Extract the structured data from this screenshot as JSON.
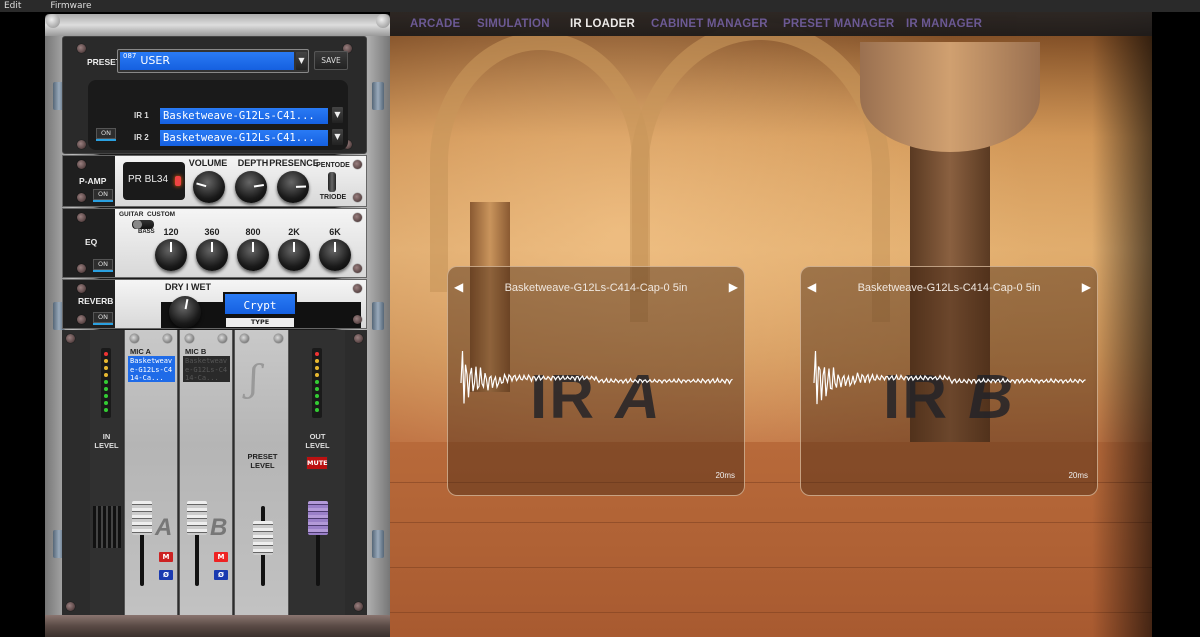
{
  "menubar": {
    "items": [
      "Edit",
      "Firmware"
    ]
  },
  "nav": {
    "tabs": [
      {
        "label": "ARCADE",
        "active": false
      },
      {
        "label": "SIMULATION",
        "active": false
      },
      {
        "label": "IR LOADER",
        "active": true
      },
      {
        "label": "CABINET MANAGER",
        "active": false
      },
      {
        "label": "PRESET MANAGER",
        "active": false
      },
      {
        "label": "IR MANAGER",
        "active": false
      }
    ],
    "active_color": "#f2f2f2",
    "inactive_color": "#6b5a9a"
  },
  "preset": {
    "label": "PRESET",
    "number": "087",
    "name": "USER",
    "save_label": "SAVE"
  },
  "ir_loader": {
    "ir1_label": "IR 1",
    "ir1_value": "Basketweave-G12Ls-C41...",
    "ir2_label": "IR 2",
    "ir2_value": "Basketweave-G12Ls-C41...",
    "on_label": "ON"
  },
  "pamp": {
    "label": "P-AMP",
    "on_label": "ON",
    "tube": "PR BL34",
    "knobs": [
      {
        "label": "VOLUME",
        "value": -0.55
      },
      {
        "label": "DEPTH",
        "value": 0.6
      },
      {
        "label": "PRESENCE",
        "value": 0.65
      }
    ],
    "switch_top": "PENTODE",
    "switch_bottom": "TRIODE"
  },
  "eq": {
    "label": "EQ",
    "on_label": "ON",
    "mode_left": "GUITAR",
    "mode_right": "CUSTOM",
    "mode_bottom": "BASS",
    "bands": [
      {
        "label": "120",
        "value": 0
      },
      {
        "label": "360",
        "value": 0
      },
      {
        "label": "800",
        "value": 0
      },
      {
        "label": "2K",
        "value": 0
      },
      {
        "label": "6K",
        "value": 0
      }
    ]
  },
  "reverb": {
    "label": "REVERB",
    "on_label": "ON",
    "drywet_label": "DRY I WET",
    "drywet_value": 0.08,
    "type_value": "Crypt",
    "type_label": "TYPE"
  },
  "mixer": {
    "in_level_label": "IN\nLEVEL",
    "mic_a_label": "MIC A",
    "mic_a_value": "Basketweave-G12Ls-C414-Ca...",
    "mic_b_label": "MIC B",
    "mic_b_value": "Basketweave-G12Ls-C414-Ca...",
    "fader_a_letter": "A",
    "fader_b_letter": "B",
    "mute_short": "M",
    "phase_symbol": "Ø",
    "preset_level_label": "PRESET\nLEVEL",
    "out_level_label": "OUT\nLEVEL",
    "mute_label": "MUTE",
    "fader_a_level": 0.85,
    "fader_b_level": 0.85,
    "fader_preset_level": 0.6,
    "fader_out_level": 0.85
  },
  "ir_panels": [
    {
      "title": "Basketweave-G12Ls-C414-Cap-0 5in",
      "big_label_1": "IR",
      "big_label_2": "A",
      "time_label": "20ms"
    },
    {
      "title": "Basketweave-G12Ls-C414-Cap-0 5in",
      "big_label_1": "IR",
      "big_label_2": "B",
      "time_label": "20ms"
    }
  ],
  "icons": {
    "prev": "◀",
    "next": "▶",
    "dropdown": "▼"
  }
}
